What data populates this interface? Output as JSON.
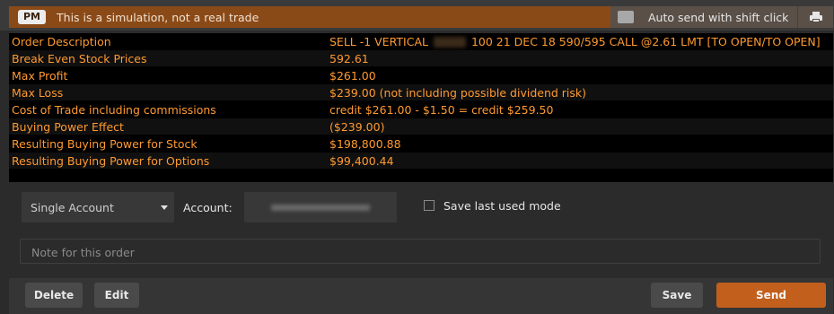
{
  "banner": {
    "badge": "PM",
    "message": "This is a simulation, not a real trade",
    "auto_send_label": "Auto send with shift click",
    "print_icon": "printer-icon"
  },
  "details": [
    {
      "label": "Order Description",
      "value_pre": "SELL -1 VERTICAL",
      "value_post": "100 21 DEC 18 590/595 CALL @2.61 LMT [TO OPEN/TO OPEN]"
    },
    {
      "label": "Break Even Stock Prices",
      "value": "592.61"
    },
    {
      "label": "Max Profit",
      "value": "$261.00"
    },
    {
      "label": "Max Loss",
      "value": "$239.00 (not including possible dividend risk)"
    },
    {
      "label": "Cost of Trade including commissions",
      "value": "credit $261.00 - $1.50 = credit $259.50"
    },
    {
      "label": "Buying Power Effect",
      "value": "($239.00)"
    },
    {
      "label": "Resulting Buying Power for Stock",
      "value": "$198,800.88"
    },
    {
      "label": "Resulting Buying Power for Options",
      "value": "$99,400.44"
    }
  ],
  "account": {
    "mode": "Single Account",
    "label": "Account:",
    "save_mode_label": "Save last used mode"
  },
  "note": {
    "placeholder": "Note for this order"
  },
  "footer": {
    "delete": "Delete",
    "edit": "Edit",
    "save": "Save",
    "send": "Send"
  },
  "colors": {
    "accent": "#c25f1c",
    "detail_text": "#ff9a30",
    "banner_bg": "#8a4a18"
  }
}
